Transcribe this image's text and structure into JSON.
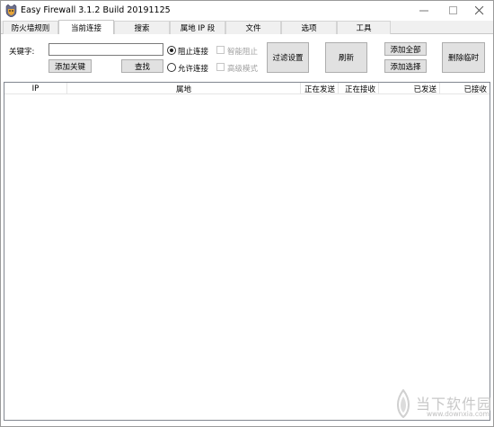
{
  "window": {
    "title": "Easy Firewall 3.1.2 Build 20191125"
  },
  "tabs": [
    {
      "label": "防火墙规则"
    },
    {
      "label": "当前连接"
    },
    {
      "label": "搜索"
    },
    {
      "label": "属地 IP 段"
    },
    {
      "label": "文件"
    },
    {
      "label": "选项"
    },
    {
      "label": "工具"
    }
  ],
  "active_tab": "当前连接",
  "controls": {
    "keyword_label": "关键字:",
    "keyword_value": "",
    "add_keyword_button": "添加关键",
    "find_button": "查找",
    "radio_block": "阻止连接",
    "radio_allow": "允许连接",
    "radio_selected": "阻止连接",
    "check_smart_block": "智能阻止",
    "check_advanced_mode": "高级模式",
    "filter_settings_button": "过滤设置",
    "refresh_button": "刷新",
    "add_all_button": "添加全部",
    "add_selected_button": "添加选择",
    "delete_temp_button": "删除临时"
  },
  "table": {
    "columns": [
      "IP",
      "属地",
      "正在发送",
      "正在接收",
      "已发送",
      "已接收"
    ],
    "rows": []
  },
  "watermark": {
    "brand": "当下软件园",
    "url": "www.downxia.com"
  }
}
